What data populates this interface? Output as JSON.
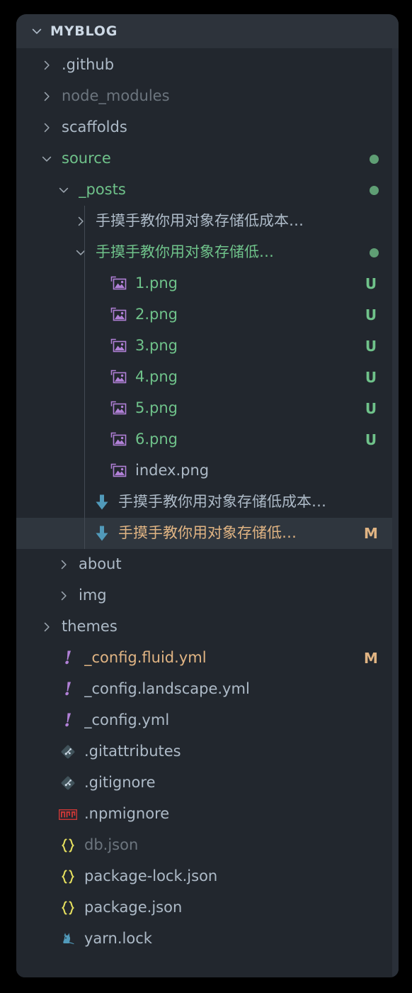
{
  "header": {
    "title": "MYBLOG",
    "twisty": "chevron-down-icon"
  },
  "colors": {
    "panel_background": "#22272e",
    "header_background": "#2d333b",
    "selected_row_background": "#2f363e",
    "text_default": "#adbac7",
    "text_ignored": "#6c757e",
    "git_untracked_green": "#6fc28a",
    "git_modified_amber": "#e0b483",
    "folder_dot_green": "#5f9e74",
    "icon_image_purple": "#b180d7",
    "icon_download_blue": "#519aba",
    "icon_yaml_purple": "#b180d7",
    "icon_json_yellow": "#e6e05f",
    "icon_npm_red": "#cb3837",
    "icon_yarn_blue": "#519aba",
    "icon_git_slate": "#41535b",
    "frame_black": "#000000"
  },
  "tree": [
    {
      "label": ".github",
      "twisty": "chevron-right-icon",
      "icon": "none",
      "depth": 1,
      "color": "normal",
      "status": "",
      "dot": false,
      "selected": false,
      "guides": 0
    },
    {
      "label": "node_modules",
      "twisty": "chevron-right-icon",
      "icon": "none",
      "depth": 1,
      "color": "dim",
      "status": "",
      "dot": false,
      "selected": false,
      "guides": 0
    },
    {
      "label": "scaffolds",
      "twisty": "chevron-right-icon",
      "icon": "none",
      "depth": 1,
      "color": "normal",
      "status": "",
      "dot": false,
      "selected": false,
      "guides": 0
    },
    {
      "label": "source",
      "twisty": "chevron-down-icon",
      "icon": "none",
      "depth": 1,
      "color": "green",
      "status": "",
      "dot": true,
      "selected": false,
      "guides": 0
    },
    {
      "label": "_posts",
      "twisty": "chevron-down-icon",
      "icon": "none",
      "depth": 2,
      "color": "green",
      "status": "",
      "dot": true,
      "selected": false,
      "guides": 0
    },
    {
      "label": "手摸手教你用对象存储低成本…",
      "twisty": "chevron-right-icon",
      "icon": "none",
      "depth": 3,
      "color": "normal",
      "status": "",
      "dot": false,
      "selected": false,
      "guides": 1
    },
    {
      "label": "手摸手教你用对象存储低…",
      "twisty": "chevron-down-icon",
      "icon": "none",
      "depth": 3,
      "color": "green",
      "status": "",
      "dot": true,
      "selected": false,
      "guides": 1
    },
    {
      "label": "1.png",
      "twisty": "none",
      "icon": "image-icon",
      "depth": 4,
      "color": "green",
      "status": "U",
      "dot": false,
      "selected": false,
      "guides": 1
    },
    {
      "label": "2.png",
      "twisty": "none",
      "icon": "image-icon",
      "depth": 4,
      "color": "green",
      "status": "U",
      "dot": false,
      "selected": false,
      "guides": 1
    },
    {
      "label": "3.png",
      "twisty": "none",
      "icon": "image-icon",
      "depth": 4,
      "color": "green",
      "status": "U",
      "dot": false,
      "selected": false,
      "guides": 1
    },
    {
      "label": "4.png",
      "twisty": "none",
      "icon": "image-icon",
      "depth": 4,
      "color": "green",
      "status": "U",
      "dot": false,
      "selected": false,
      "guides": 1
    },
    {
      "label": "5.png",
      "twisty": "none",
      "icon": "image-icon",
      "depth": 4,
      "color": "green",
      "status": "U",
      "dot": false,
      "selected": false,
      "guides": 1
    },
    {
      "label": "6.png",
      "twisty": "none",
      "icon": "image-icon",
      "depth": 4,
      "color": "green",
      "status": "U",
      "dot": false,
      "selected": false,
      "guides": 1
    },
    {
      "label": "index.png",
      "twisty": "none",
      "icon": "image-icon",
      "depth": 4,
      "color": "normal",
      "status": "",
      "dot": false,
      "selected": false,
      "guides": 1
    },
    {
      "label": "手摸手教你用对象存储低成本…",
      "twisty": "none",
      "icon": "markdown-download-icon",
      "depth": 3,
      "color": "normal",
      "status": "",
      "dot": false,
      "selected": false,
      "guides": 1
    },
    {
      "label": "手摸手教你用对象存储低…",
      "twisty": "none",
      "icon": "markdown-download-icon",
      "depth": 3,
      "color": "amber",
      "status": "M",
      "dot": false,
      "selected": true,
      "guides": 1
    },
    {
      "label": "about",
      "twisty": "chevron-right-icon",
      "icon": "none",
      "depth": 2,
      "color": "normal",
      "status": "",
      "dot": false,
      "selected": false,
      "guides": 0
    },
    {
      "label": "img",
      "twisty": "chevron-right-icon",
      "icon": "none",
      "depth": 2,
      "color": "normal",
      "status": "",
      "dot": false,
      "selected": false,
      "guides": 0
    },
    {
      "label": "themes",
      "twisty": "chevron-right-icon",
      "icon": "none",
      "depth": 1,
      "color": "normal",
      "status": "",
      "dot": false,
      "selected": false,
      "guides": 0
    },
    {
      "label": "_config.fluid.yml",
      "twisty": "none",
      "icon": "yaml-icon",
      "depth": 1,
      "color": "amber",
      "status": "M",
      "dot": false,
      "selected": false,
      "guides": 0
    },
    {
      "label": "_config.landscape.yml",
      "twisty": "none",
      "icon": "yaml-icon",
      "depth": 1,
      "color": "normal",
      "status": "",
      "dot": false,
      "selected": false,
      "guides": 0
    },
    {
      "label": "_config.yml",
      "twisty": "none",
      "icon": "yaml-icon",
      "depth": 1,
      "color": "normal",
      "status": "",
      "dot": false,
      "selected": false,
      "guides": 0
    },
    {
      "label": ".gitattributes",
      "twisty": "none",
      "icon": "git-icon",
      "depth": 1,
      "color": "normal",
      "status": "",
      "dot": false,
      "selected": false,
      "guides": 0
    },
    {
      "label": ".gitignore",
      "twisty": "none",
      "icon": "git-icon",
      "depth": 1,
      "color": "normal",
      "status": "",
      "dot": false,
      "selected": false,
      "guides": 0
    },
    {
      "label": ".npmignore",
      "twisty": "none",
      "icon": "npm-icon",
      "depth": 1,
      "color": "normal",
      "status": "",
      "dot": false,
      "selected": false,
      "guides": 0
    },
    {
      "label": "db.json",
      "twisty": "none",
      "icon": "json-icon",
      "depth": 1,
      "color": "dim",
      "status": "",
      "dot": false,
      "selected": false,
      "guides": 0
    },
    {
      "label": "package-lock.json",
      "twisty": "none",
      "icon": "json-icon",
      "depth": 1,
      "color": "normal",
      "status": "",
      "dot": false,
      "selected": false,
      "guides": 0
    },
    {
      "label": "package.json",
      "twisty": "none",
      "icon": "json-icon",
      "depth": 1,
      "color": "normal",
      "status": "",
      "dot": false,
      "selected": false,
      "guides": 0
    },
    {
      "label": "yarn.lock",
      "twisty": "none",
      "icon": "yarn-icon",
      "depth": 1,
      "color": "normal",
      "status": "",
      "dot": false,
      "selected": false,
      "guides": 0
    }
  ]
}
